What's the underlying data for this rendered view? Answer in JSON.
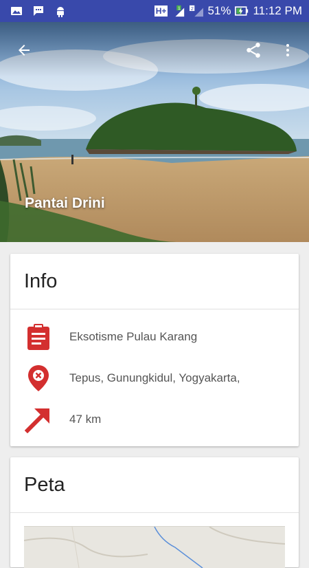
{
  "status_bar": {
    "network": "H+",
    "sim1": "1",
    "sim2": "2",
    "battery_percent": "51%",
    "time": "11:12 PM"
  },
  "hero": {
    "title": "Pantai Drini"
  },
  "info_card": {
    "header": "Info",
    "rows": [
      {
        "icon": "clipboard-icon",
        "text": "Eksotisme Pulau Karang"
      },
      {
        "icon": "location-pin-icon",
        "text": "Tepus, Gunungkidul, Yogyakarta,"
      },
      {
        "icon": "arrow-up-right-icon",
        "text": "47 km"
      }
    ]
  },
  "map_card": {
    "header": "Peta"
  },
  "colors": {
    "status_bar": "#3949ab",
    "accent_red": "#d32f2f",
    "background": "#eeeeee"
  }
}
